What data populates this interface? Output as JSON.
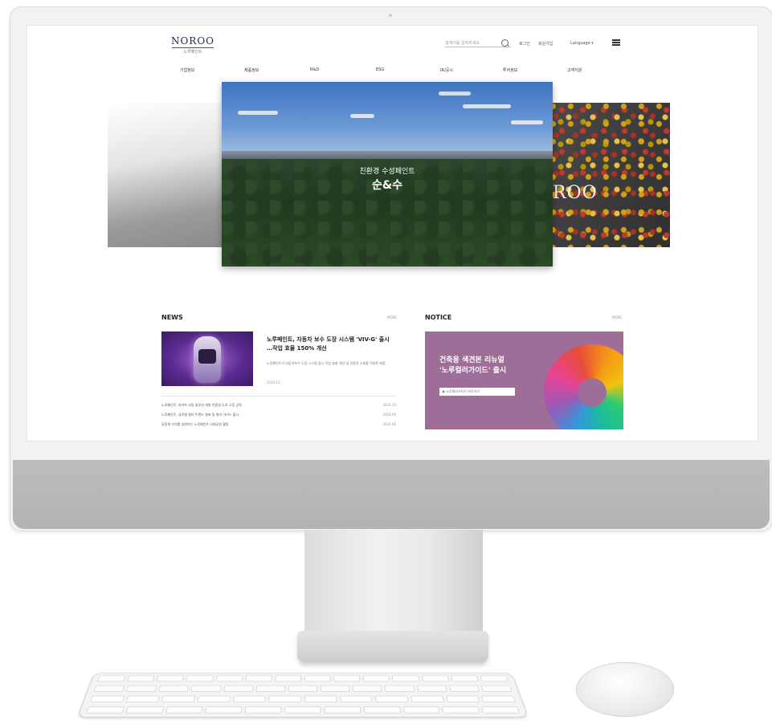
{
  "site": {
    "logo": "NOROO",
    "logo_sub": "노루페인트",
    "search_placeholder": "검색어를 입력하세요",
    "util": {
      "login": "로그인",
      "join": "회원가입",
      "language": "Language"
    },
    "gnb": [
      "기업정보",
      "제품정보",
      "R&D",
      "ESG",
      "IR/공시",
      "투자정보",
      "고객지원"
    ]
  },
  "hero": {
    "caption_sub": "친환경 수성페인트",
    "caption_main": "순&수",
    "right_slide_text": "ROO"
  },
  "news": {
    "title": "NEWS",
    "more": "MORE",
    "headline": "노루페인트, 자동차 보수 도장 시스템 'VIV-G' 출시 …작업 효율 150% 개선",
    "desc": "노루페인트가 자동차보수 도장 시스템 출시 작업 효율 개선 및 친환경 소재를 적용한 제품",
    "date": "2024.11",
    "items": [
      {
        "text": "노루페인트, 파이프 코팅 솔루션 개발 친환경 도료 시장 공략",
        "date": "2024.10"
      },
      {
        "text": "노루페인트, 글로벌 컬러 트렌드 발표 및 컬러 가이드 출시",
        "date": "2024.09"
      },
      {
        "text": "공동체 가치를 실현하는 노루페인트 사회공헌 활동",
        "date": "2024.08"
      }
    ]
  },
  "notice": {
    "title": "NOTICE",
    "more": "MORE",
    "banner_line1": "건축용 색견본 리뉴얼",
    "banner_line2": "'노루컬러가이드' 출시",
    "banner_button": "노루컬러가이드 바로가기"
  }
}
